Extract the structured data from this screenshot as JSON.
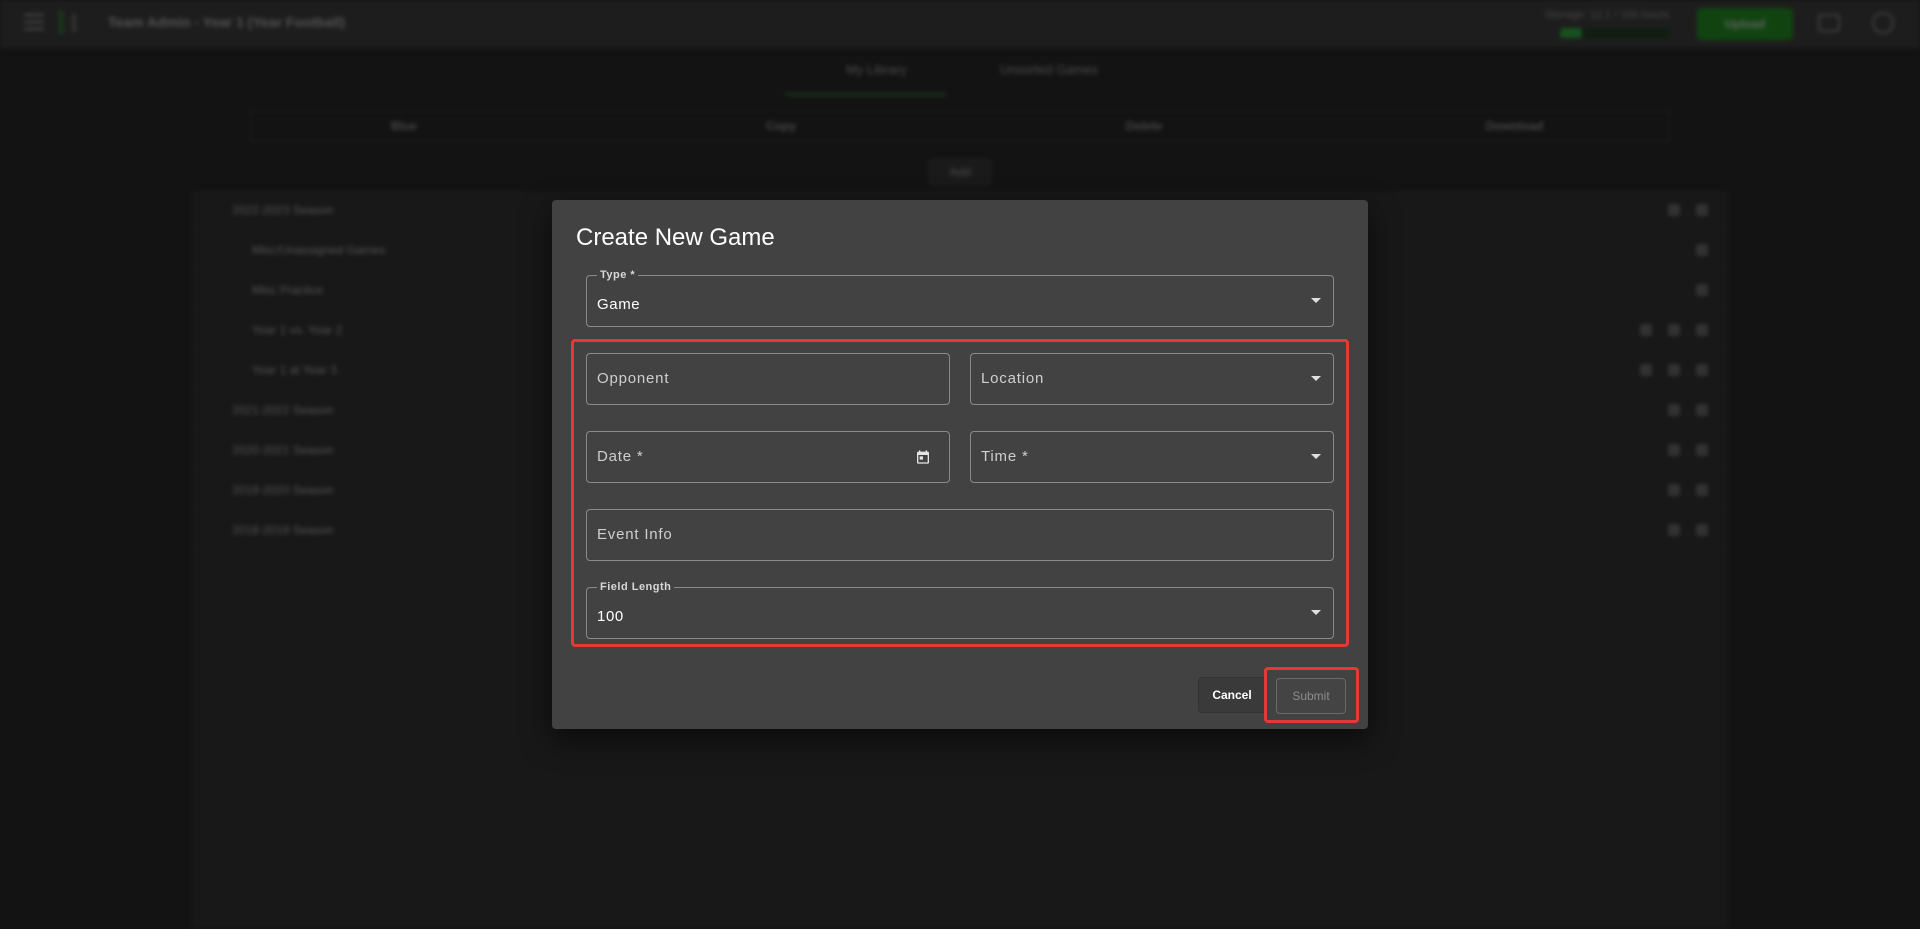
{
  "app": {
    "title": "Team Admin - Year 1 (Year Football)",
    "storage_text": "Storage: 12.1 / 100 hours",
    "storage_fraction": 0.2,
    "upload_label": "Upload",
    "tabs": [
      {
        "label": "My Library"
      },
      {
        "label": "Unsorted Games"
      }
    ],
    "columns": [
      "Blue",
      "Copy",
      "Delete",
      "Download"
    ],
    "add_label": "Add",
    "list_rows": [
      {
        "label": "2022-2023 Season"
      },
      {
        "label": "Misc/Unassigned Games"
      },
      {
        "label": "Misc Practice"
      },
      {
        "label": "Year 1 vs. Year 2"
      },
      {
        "label": "Year 1 at Year 3"
      },
      {
        "label": "2021-2022 Season"
      },
      {
        "label": "2020-2021 Season"
      },
      {
        "label": "2019-2020 Season"
      },
      {
        "label": "2018-2019 Season"
      }
    ]
  },
  "dialog": {
    "title": "Create New Game",
    "type_label": "Type *",
    "type_value": "Game",
    "opponent_placeholder": "Opponent",
    "location_placeholder": "Location",
    "date_placeholder": "Date *",
    "time_placeholder": "Time *",
    "event_info_placeholder": "Event Info",
    "field_length_label": "Field Length",
    "field_length_value": "100",
    "cancel_label": "Cancel",
    "submit_label": "Submit"
  }
}
